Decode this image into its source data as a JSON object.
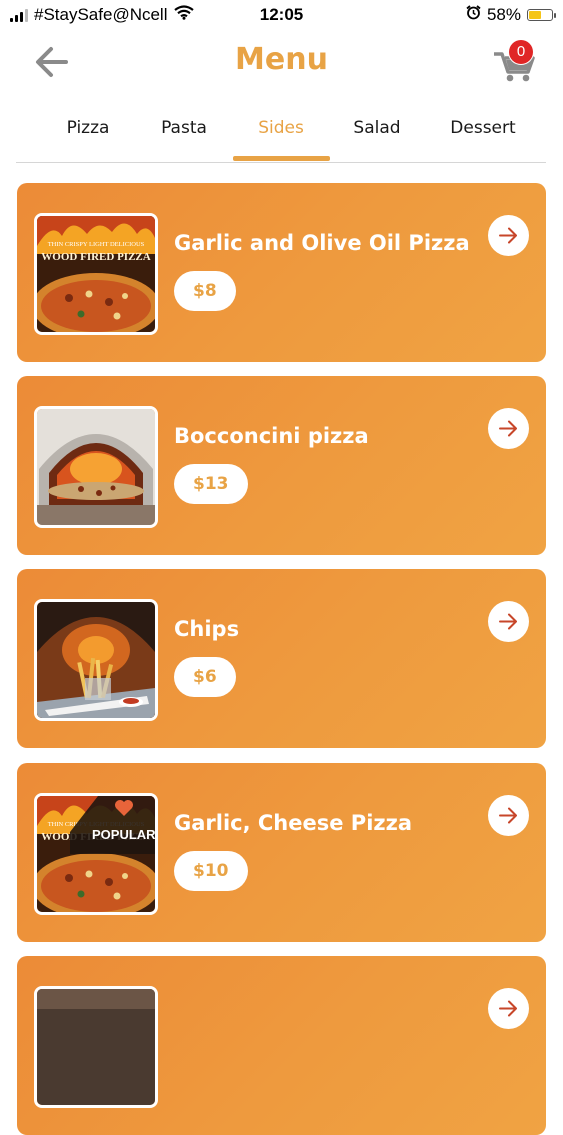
{
  "status_bar": {
    "carrier": "#StaySafe@Ncell",
    "time": "12:05",
    "battery_percent": "58%",
    "battery_level": 0.58
  },
  "header": {
    "title": "Menu",
    "back_icon": "arrow-left-icon",
    "cart_icon": "shopping-cart-icon",
    "cart_count": "0"
  },
  "tabs": [
    {
      "label": "Pizza",
      "active": false
    },
    {
      "label": "Pasta",
      "active": false
    },
    {
      "label": "Sides",
      "active": true
    },
    {
      "label": "Salad",
      "active": false
    },
    {
      "label": "Dessert",
      "active": false
    }
  ],
  "items": [
    {
      "name": "Garlic and Olive Oil Pizza",
      "price": "$8",
      "image": "wood-fired-pizza",
      "image_text": [
        "THIN CRISPY LIGHT DELICIOUS",
        "WOOD FIRED PIZZA"
      ]
    },
    {
      "name": "Bocconcini pizza",
      "price": "$13",
      "image": "pizza-oven"
    },
    {
      "name": "Chips",
      "price": "$6",
      "image": "chips"
    },
    {
      "name": "Garlic, Cheese Pizza",
      "price": "$10",
      "image": "wood-fired-pizza",
      "popular_label": "POPULAR",
      "image_text": [
        "THIN CRISPY LIGHT DELICIOUS",
        "WOOD FIRED PIZZA"
      ]
    }
  ],
  "colors": {
    "accent": "#e8a345",
    "card_start": "#ec8b37",
    "card_end": "#f0a343",
    "badge": "#e02626"
  }
}
